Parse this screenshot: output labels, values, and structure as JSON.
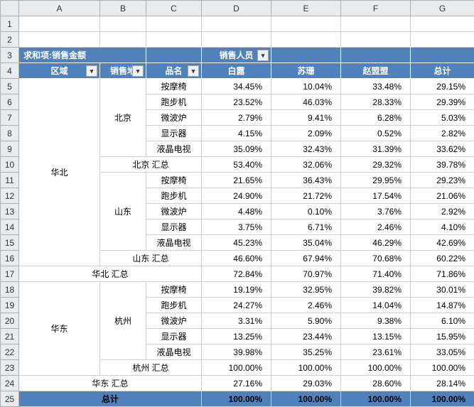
{
  "columns": [
    "A",
    "B",
    "C",
    "D",
    "E",
    "F",
    "G"
  ],
  "rownums": [
    1,
    2,
    3,
    4,
    5,
    6,
    7,
    8,
    9,
    10,
    11,
    12,
    13,
    14,
    15,
    16,
    17,
    18,
    19,
    20,
    21,
    22,
    23,
    24,
    25
  ],
  "labels": {
    "sum_field": "求和项:销售金额",
    "sales_staff": "销售人员",
    "region": "区域",
    "sales_loc": "销售地",
    "product": "品名",
    "bailu": "白露",
    "sushan": "苏珊",
    "zhaomeng": "赵盟盟",
    "total": "总计",
    "grand_total": "总计",
    "beijing": "北京",
    "shandong": "山东",
    "hangzhou": "杭州",
    "huabei": "华北",
    "huadong": "华东",
    "beijing_sub": "北京 汇总",
    "shandong_sub": "山东 汇总",
    "hangzhou_sub": "杭州 汇总",
    "huabei_sub": "华北 汇总",
    "huadong_sub": "华东 汇总",
    "p_massage": "按摩椅",
    "p_tread": "跑步机",
    "p_micro": "微波炉",
    "p_monitor": "显示器",
    "p_tv": "液晶电视"
  },
  "chart_data": {
    "type": "table",
    "title": "求和项:销售金额",
    "column_field": "销售人员",
    "row_fields": [
      "区域",
      "销售地",
      "品名"
    ],
    "columns": [
      "白露",
      "苏珊",
      "赵盟盟",
      "总计"
    ],
    "rows": [
      {
        "region": "华北",
        "loc": "北京",
        "product": "按摩椅",
        "values": [
          "34.45%",
          "10.04%",
          "33.48%",
          "29.15%"
        ]
      },
      {
        "region": "华北",
        "loc": "北京",
        "product": "跑步机",
        "values": [
          "23.52%",
          "46.03%",
          "28.33%",
          "29.39%"
        ]
      },
      {
        "region": "华北",
        "loc": "北京",
        "product": "微波炉",
        "values": [
          "2.79%",
          "9.41%",
          "6.28%",
          "5.03%"
        ]
      },
      {
        "region": "华北",
        "loc": "北京",
        "product": "显示器",
        "values": [
          "4.15%",
          "2.09%",
          "0.52%",
          "2.82%"
        ]
      },
      {
        "region": "华北",
        "loc": "北京",
        "product": "液晶电视",
        "values": [
          "35.09%",
          "32.43%",
          "31.39%",
          "33.62%"
        ]
      },
      {
        "subtotal": "北京 汇总",
        "values": [
          "53.40%",
          "32.06%",
          "29.32%",
          "39.78%"
        ]
      },
      {
        "region": "华北",
        "loc": "山东",
        "product": "按摩椅",
        "values": [
          "21.65%",
          "36.43%",
          "29.95%",
          "29.23%"
        ]
      },
      {
        "region": "华北",
        "loc": "山东",
        "product": "跑步机",
        "values": [
          "24.90%",
          "21.72%",
          "17.54%",
          "21.06%"
        ]
      },
      {
        "region": "华北",
        "loc": "山东",
        "product": "微波炉",
        "values": [
          "4.48%",
          "0.10%",
          "3.76%",
          "2.92%"
        ]
      },
      {
        "region": "华北",
        "loc": "山东",
        "product": "显示器",
        "values": [
          "3.75%",
          "6.71%",
          "2.46%",
          "4.10%"
        ]
      },
      {
        "region": "华北",
        "loc": "山东",
        "product": "液晶电视",
        "values": [
          "45.23%",
          "35.04%",
          "46.29%",
          "42.69%"
        ]
      },
      {
        "subtotal": "山东 汇总",
        "values": [
          "46.60%",
          "67.94%",
          "70.68%",
          "60.22%"
        ]
      },
      {
        "subtotal": "华北 汇总",
        "values": [
          "72.84%",
          "70.97%",
          "71.40%",
          "71.86%"
        ]
      },
      {
        "region": "华东",
        "loc": "杭州",
        "product": "按摩椅",
        "values": [
          "19.19%",
          "32.95%",
          "39.82%",
          "30.01%"
        ]
      },
      {
        "region": "华东",
        "loc": "杭州",
        "product": "跑步机",
        "values": [
          "24.27%",
          "2.46%",
          "14.04%",
          "14.87%"
        ]
      },
      {
        "region": "华东",
        "loc": "杭州",
        "product": "微波炉",
        "values": [
          "3.31%",
          "5.90%",
          "9.38%",
          "6.10%"
        ]
      },
      {
        "region": "华东",
        "loc": "杭州",
        "product": "显示器",
        "values": [
          "13.25%",
          "23.44%",
          "13.15%",
          "15.95%"
        ]
      },
      {
        "region": "华东",
        "loc": "杭州",
        "product": "液晶电视",
        "values": [
          "39.98%",
          "35.25%",
          "23.61%",
          "33.05%"
        ]
      },
      {
        "subtotal": "杭州 汇总",
        "values": [
          "100.00%",
          "100.00%",
          "100.00%",
          "100.00%"
        ]
      },
      {
        "subtotal": "华东 汇总",
        "values": [
          "27.16%",
          "29.03%",
          "28.60%",
          "28.14%"
        ]
      },
      {
        "grand": "总计",
        "values": [
          "100.00%",
          "100.00%",
          "100.00%",
          "100.00%"
        ]
      }
    ]
  }
}
